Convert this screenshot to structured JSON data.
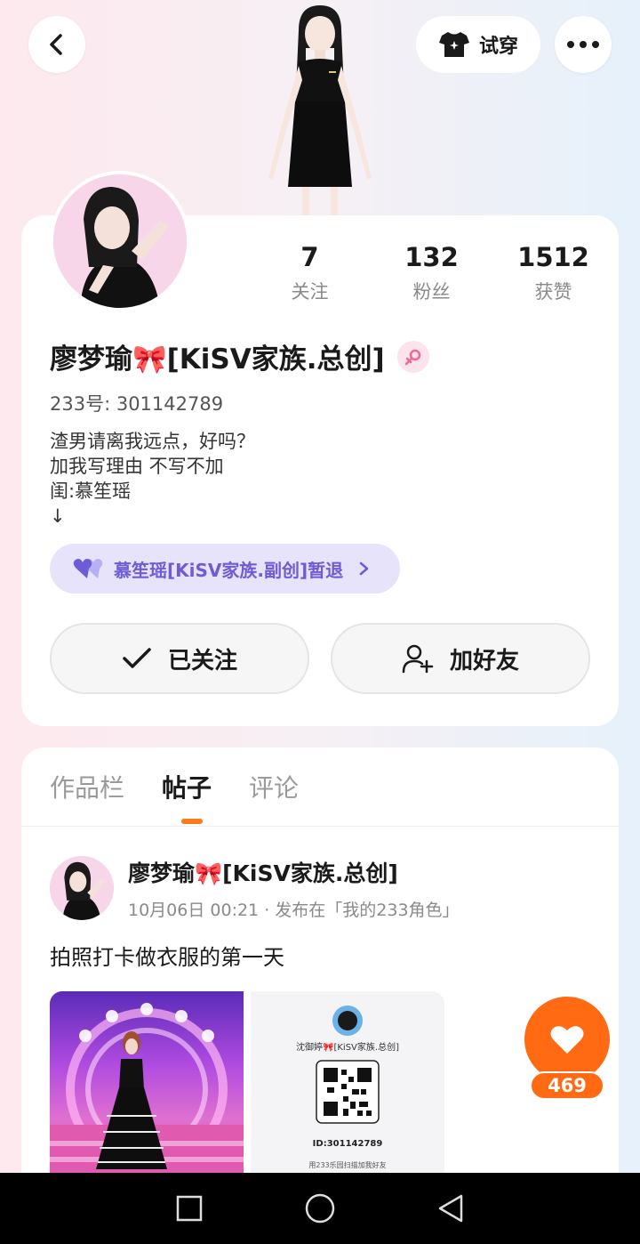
{
  "header": {
    "try_on_label": "试穿"
  },
  "stats": [
    {
      "value": "7",
      "label": "关注"
    },
    {
      "value": "132",
      "label": "粉丝"
    },
    {
      "value": "1512",
      "label": "获赞"
    }
  ],
  "profile": {
    "name": "廖梦瑜🎀[KiSV家族.总创]",
    "uid": "233号: 301142789",
    "bio": [
      "渣男请离我远点，好吗？",
      "加我写理由 不写不加",
      "闺:慕笙瑶",
      "↓"
    ],
    "family_link": "慕笙瑶[KiSV家族.副创]暂退"
  },
  "actions": {
    "follow_label": "已关注",
    "add_friend_label": "加好友"
  },
  "tabs": [
    {
      "label": "作品栏",
      "active": false
    },
    {
      "label": "帖子",
      "active": true
    },
    {
      "label": "评论",
      "active": false
    }
  ],
  "post": {
    "author": "廖梦瑜🎀[KiSV家族.总创]",
    "meta": "10月06日 00:21 · 发布在「我的233角色」",
    "text": "拍照打卡做衣服的第一天",
    "qr_name": "沈御婷🎀[KiSV家族.总创]",
    "qr_id": "ID:301142789",
    "qr_hint": "用233乐园扫描加我好友",
    "like_count": "469"
  },
  "colors": {
    "accent": "#ff6a12",
    "family_purple": "#6e5cd6"
  }
}
